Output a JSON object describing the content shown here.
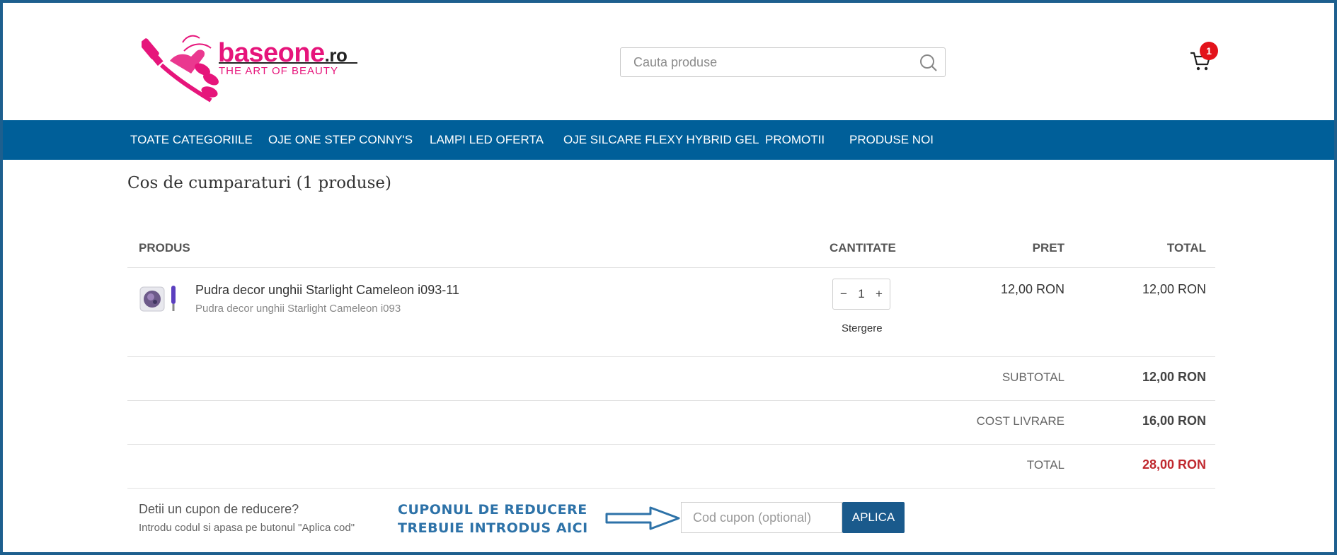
{
  "header": {
    "logo_main": "baseone",
    "logo_suffix": ".ro",
    "logo_tagline": "THE ART OF BEAUTY",
    "search_placeholder": "Cauta produse",
    "cart_count": "1"
  },
  "nav": {
    "items": [
      "TOATE CATEGORIILE",
      "OJE ONE STEP CONNY'S",
      "LAMPI LED OFERTA",
      "OJE SILCARE FLEXY HYBRID GEL",
      "PROMOTII",
      "PRODUSE NOI"
    ]
  },
  "cart": {
    "title": "Cos de cumparaturi (1 produse)",
    "columns": {
      "product": "PRODUS",
      "qty": "CANTITATE",
      "price": "PRET",
      "total": "TOTAL"
    },
    "items": [
      {
        "name": "Pudra decor unghii Starlight Cameleon i093-11",
        "variant": "Pudra decor unghii Starlight Cameleon i093",
        "qty": "1",
        "qty_minus": "−",
        "qty_plus": "+",
        "remove_label": "Stergere",
        "price": "12,00 RON",
        "total": "12,00 RON"
      }
    ],
    "summary": {
      "subtotal_label": "SUBTOTAL",
      "subtotal_value": "12,00 RON",
      "shipping_label": "COST LIVRARE",
      "shipping_value": "16,00 RON",
      "total_label": "TOTAL",
      "total_value": "28,00 RON"
    }
  },
  "coupon": {
    "question": "Detii un cupon de reducere?",
    "hint": "Introdu codul si apasa pe butonul \"Aplica cod\"",
    "annotation_line1": "CUPONUL DE REDUCERE",
    "annotation_line2": "TREBUIE INTRODUS AICI",
    "placeholder": "Cod cupon (optional)",
    "apply_label": "APLICA"
  },
  "colors": {
    "frame": "#1d5f8e",
    "nav_bg": "#005f99",
    "brand_pink": "#e6157b",
    "total_red": "#c0292f",
    "apply_bg": "#1a5a8c",
    "annotation": "#2d72a8",
    "badge": "#e3131b"
  }
}
